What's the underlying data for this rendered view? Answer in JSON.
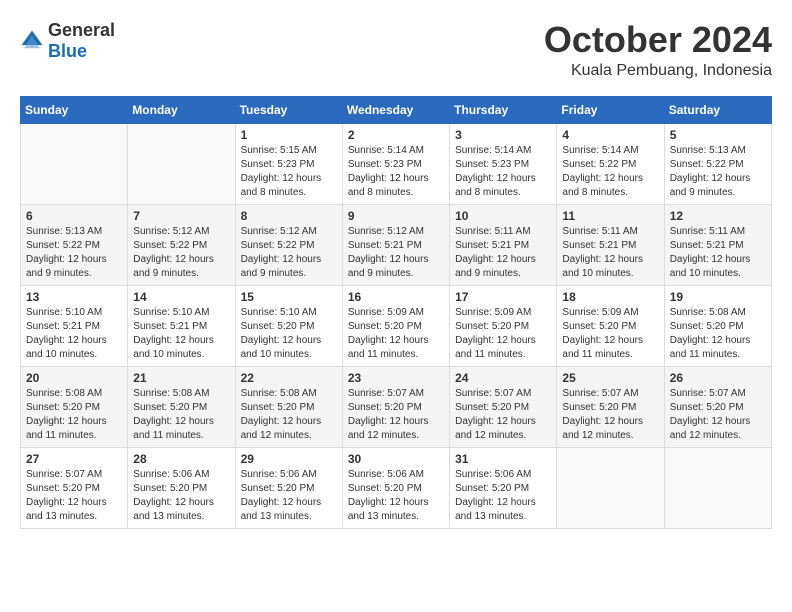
{
  "logo": {
    "general": "General",
    "blue": "Blue"
  },
  "header": {
    "month": "October 2024",
    "location": "Kuala Pembuang, Indonesia"
  },
  "weekdays": [
    "Sunday",
    "Monday",
    "Tuesday",
    "Wednesday",
    "Thursday",
    "Friday",
    "Saturday"
  ],
  "weeks": [
    {
      "shaded": false,
      "days": [
        {
          "num": "",
          "info": ""
        },
        {
          "num": "",
          "info": ""
        },
        {
          "num": "1",
          "info": "Sunrise: 5:15 AM\nSunset: 5:23 PM\nDaylight: 12 hours and 8 minutes."
        },
        {
          "num": "2",
          "info": "Sunrise: 5:14 AM\nSunset: 5:23 PM\nDaylight: 12 hours and 8 minutes."
        },
        {
          "num": "3",
          "info": "Sunrise: 5:14 AM\nSunset: 5:23 PM\nDaylight: 12 hours and 8 minutes."
        },
        {
          "num": "4",
          "info": "Sunrise: 5:14 AM\nSunset: 5:22 PM\nDaylight: 12 hours and 8 minutes."
        },
        {
          "num": "5",
          "info": "Sunrise: 5:13 AM\nSunset: 5:22 PM\nDaylight: 12 hours and 9 minutes."
        }
      ]
    },
    {
      "shaded": true,
      "days": [
        {
          "num": "6",
          "info": "Sunrise: 5:13 AM\nSunset: 5:22 PM\nDaylight: 12 hours and 9 minutes."
        },
        {
          "num": "7",
          "info": "Sunrise: 5:12 AM\nSunset: 5:22 PM\nDaylight: 12 hours and 9 minutes."
        },
        {
          "num": "8",
          "info": "Sunrise: 5:12 AM\nSunset: 5:22 PM\nDaylight: 12 hours and 9 minutes."
        },
        {
          "num": "9",
          "info": "Sunrise: 5:12 AM\nSunset: 5:21 PM\nDaylight: 12 hours and 9 minutes."
        },
        {
          "num": "10",
          "info": "Sunrise: 5:11 AM\nSunset: 5:21 PM\nDaylight: 12 hours and 9 minutes."
        },
        {
          "num": "11",
          "info": "Sunrise: 5:11 AM\nSunset: 5:21 PM\nDaylight: 12 hours and 10 minutes."
        },
        {
          "num": "12",
          "info": "Sunrise: 5:11 AM\nSunset: 5:21 PM\nDaylight: 12 hours and 10 minutes."
        }
      ]
    },
    {
      "shaded": false,
      "days": [
        {
          "num": "13",
          "info": "Sunrise: 5:10 AM\nSunset: 5:21 PM\nDaylight: 12 hours and 10 minutes."
        },
        {
          "num": "14",
          "info": "Sunrise: 5:10 AM\nSunset: 5:21 PM\nDaylight: 12 hours and 10 minutes."
        },
        {
          "num": "15",
          "info": "Sunrise: 5:10 AM\nSunset: 5:20 PM\nDaylight: 12 hours and 10 minutes."
        },
        {
          "num": "16",
          "info": "Sunrise: 5:09 AM\nSunset: 5:20 PM\nDaylight: 12 hours and 11 minutes."
        },
        {
          "num": "17",
          "info": "Sunrise: 5:09 AM\nSunset: 5:20 PM\nDaylight: 12 hours and 11 minutes."
        },
        {
          "num": "18",
          "info": "Sunrise: 5:09 AM\nSunset: 5:20 PM\nDaylight: 12 hours and 11 minutes."
        },
        {
          "num": "19",
          "info": "Sunrise: 5:08 AM\nSunset: 5:20 PM\nDaylight: 12 hours and 11 minutes."
        }
      ]
    },
    {
      "shaded": true,
      "days": [
        {
          "num": "20",
          "info": "Sunrise: 5:08 AM\nSunset: 5:20 PM\nDaylight: 12 hours and 11 minutes."
        },
        {
          "num": "21",
          "info": "Sunrise: 5:08 AM\nSunset: 5:20 PM\nDaylight: 12 hours and 11 minutes."
        },
        {
          "num": "22",
          "info": "Sunrise: 5:08 AM\nSunset: 5:20 PM\nDaylight: 12 hours and 12 minutes."
        },
        {
          "num": "23",
          "info": "Sunrise: 5:07 AM\nSunset: 5:20 PM\nDaylight: 12 hours and 12 minutes."
        },
        {
          "num": "24",
          "info": "Sunrise: 5:07 AM\nSunset: 5:20 PM\nDaylight: 12 hours and 12 minutes."
        },
        {
          "num": "25",
          "info": "Sunrise: 5:07 AM\nSunset: 5:20 PM\nDaylight: 12 hours and 12 minutes."
        },
        {
          "num": "26",
          "info": "Sunrise: 5:07 AM\nSunset: 5:20 PM\nDaylight: 12 hours and 12 minutes."
        }
      ]
    },
    {
      "shaded": false,
      "days": [
        {
          "num": "27",
          "info": "Sunrise: 5:07 AM\nSunset: 5:20 PM\nDaylight: 12 hours and 13 minutes."
        },
        {
          "num": "28",
          "info": "Sunrise: 5:06 AM\nSunset: 5:20 PM\nDaylight: 12 hours and 13 minutes."
        },
        {
          "num": "29",
          "info": "Sunrise: 5:06 AM\nSunset: 5:20 PM\nDaylight: 12 hours and 13 minutes."
        },
        {
          "num": "30",
          "info": "Sunrise: 5:06 AM\nSunset: 5:20 PM\nDaylight: 12 hours and 13 minutes."
        },
        {
          "num": "31",
          "info": "Sunrise: 5:06 AM\nSunset: 5:20 PM\nDaylight: 12 hours and 13 minutes."
        },
        {
          "num": "",
          "info": ""
        },
        {
          "num": "",
          "info": ""
        }
      ]
    }
  ]
}
